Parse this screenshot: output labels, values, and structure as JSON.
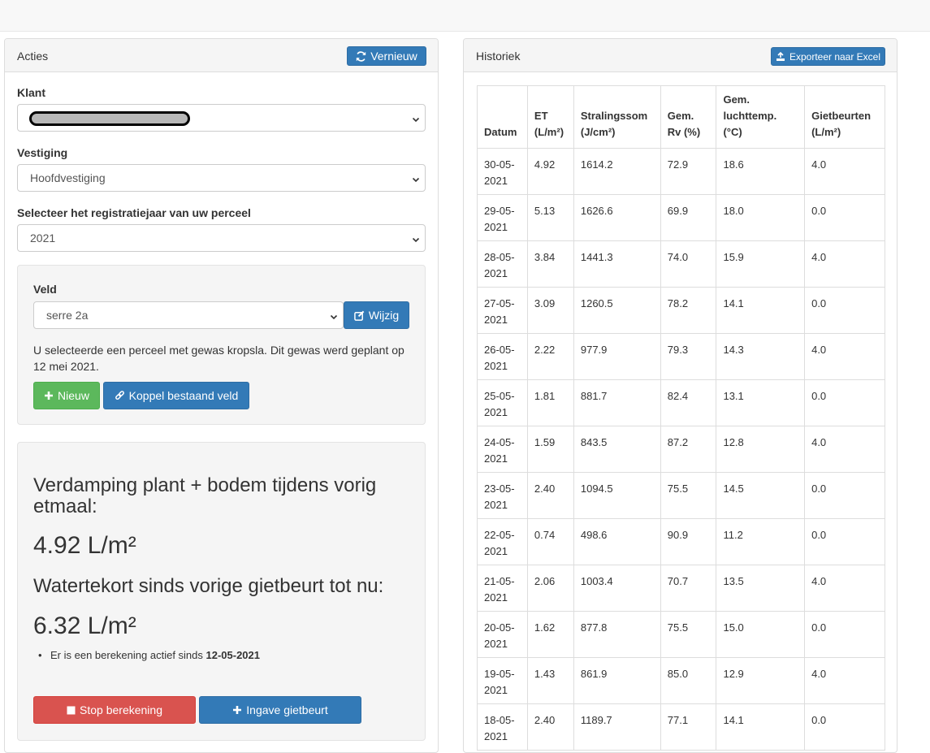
{
  "left_panel": {
    "title": "Acties",
    "vernieuw_label": "Vernieuw",
    "klant_label": "Klant",
    "vestiging_label": "Vestiging",
    "vestiging_value": "Hoofdvestiging",
    "jaar_label": "Selecteer het registratiejaar van uw perceel",
    "jaar_value": "2021",
    "veld": {
      "label": "Veld",
      "value": "serre 2a",
      "wijzig_label": "Wijzig",
      "info": "U selecteerde een perceel met gewas kropsla. Dit gewas werd geplant op 12 mei 2021.",
      "nieuw_label": "Nieuw",
      "koppel_label": "Koppel bestaand veld"
    },
    "calc": {
      "verdamping_heading": "Verdamping plant + bodem tijdens vorig etmaal:",
      "verdamping_value": "4.92 L/m²",
      "tekort_heading": "Watertekort sinds vorige gietbeurt tot nu:",
      "tekort_value": "6.32 L/m²",
      "bullet_text": "Er is een berekening actief sinds ",
      "bullet_date": "12-05-2021",
      "stop_label": "Stop berekening",
      "ingave_label": "Ingave gietbeurt"
    }
  },
  "right_panel": {
    "title": "Historiek",
    "export_label": "Exporteer naar Excel",
    "columns": [
      "Datum",
      "ET (L/m²)",
      "Stralingssom (J/cm²)",
      "Gem. Rv (%)",
      "Gem. luchttemp. (°C)",
      "Gietbeurten (L/m²)"
    ],
    "rows": [
      [
        "30-05-2021",
        "4.92",
        "1614.2",
        "72.9",
        "18.6",
        "4.0"
      ],
      [
        "29-05-2021",
        "5.13",
        "1626.6",
        "69.9",
        "18.0",
        "0.0"
      ],
      [
        "28-05-2021",
        "3.84",
        "1441.3",
        "74.0",
        "15.9",
        "4.0"
      ],
      [
        "27-05-2021",
        "3.09",
        "1260.5",
        "78.2",
        "14.1",
        "0.0"
      ],
      [
        "26-05-2021",
        "2.22",
        "977.9",
        "79.3",
        "14.3",
        "4.0"
      ],
      [
        "25-05-2021",
        "1.81",
        "881.7",
        "82.4",
        "13.1",
        "0.0"
      ],
      [
        "24-05-2021",
        "1.59",
        "843.5",
        "87.2",
        "12.8",
        "4.0"
      ],
      [
        "23-05-2021",
        "2.40",
        "1094.5",
        "75.5",
        "14.5",
        "0.0"
      ],
      [
        "22-05-2021",
        "0.74",
        "498.6",
        "90.9",
        "11.2",
        "0.0"
      ],
      [
        "21-05-2021",
        "2.06",
        "1003.4",
        "70.7",
        "13.5",
        "4.0"
      ],
      [
        "20-05-2021",
        "1.62",
        "877.8",
        "75.5",
        "15.0",
        "0.0"
      ],
      [
        "19-05-2021",
        "1.43",
        "861.9",
        "85.0",
        "12.9",
        "4.0"
      ],
      [
        "18-05-2021",
        "2.40",
        "1189.7",
        "77.1",
        "14.1",
        "0.0"
      ]
    ]
  },
  "colors": {
    "primary": "#337ab7",
    "success": "#5cb85c",
    "danger": "#d9534f"
  }
}
